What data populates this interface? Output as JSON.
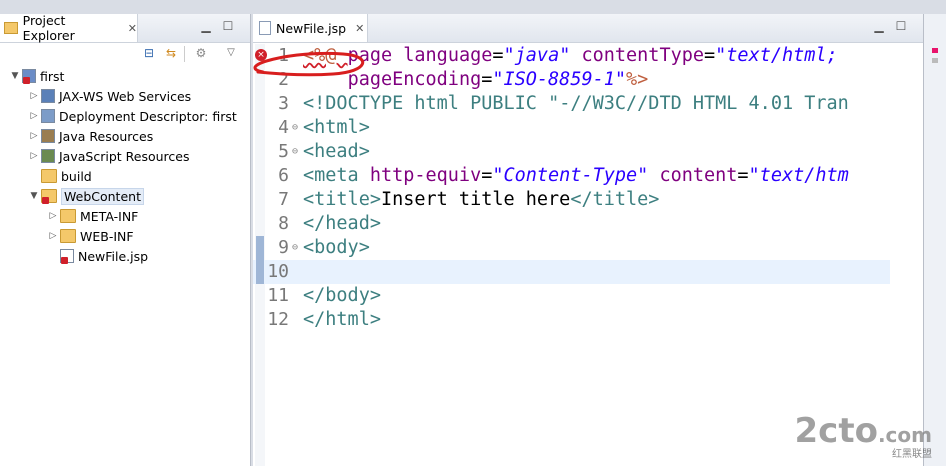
{
  "explorer": {
    "title": "Project Explorer",
    "tree": [
      {
        "label": "first",
        "indent": 0,
        "arrow": "▼",
        "icon": "project"
      },
      {
        "label": "JAX-WS Web Services",
        "indent": 1,
        "arrow": "▷",
        "icon": "ws"
      },
      {
        "label": "Deployment Descriptor: first",
        "indent": 1,
        "arrow": "▷",
        "icon": "dd"
      },
      {
        "label": "Java Resources",
        "indent": 1,
        "arrow": "▷",
        "icon": "java"
      },
      {
        "label": "JavaScript Resources",
        "indent": 1,
        "arrow": "▷",
        "icon": "js"
      },
      {
        "label": "build",
        "indent": 1,
        "arrow": "",
        "icon": "folder"
      },
      {
        "label": "WebContent",
        "indent": 1,
        "arrow": "▼",
        "icon": "webfolder",
        "selected": true
      },
      {
        "label": "META-INF",
        "indent": 2,
        "arrow": "▷",
        "icon": "folder"
      },
      {
        "label": "WEB-INF",
        "indent": 2,
        "arrow": "▷",
        "icon": "folder"
      },
      {
        "label": "NewFile.jsp",
        "indent": 2,
        "arrow": "",
        "icon": "jsp"
      }
    ]
  },
  "editor": {
    "tab_label": "NewFile.jsp",
    "lines": [
      {
        "num": "1",
        "fold": "",
        "error": true,
        "segments": [
          [
            "jsp",
            "<%@ "
          ],
          [
            "attr",
            "page "
          ],
          [
            "attr",
            "language"
          ],
          [
            "plain",
            "="
          ],
          [
            "val",
            "\"java\""
          ],
          [
            "plain",
            " "
          ],
          [
            "attr",
            "contentType"
          ],
          [
            "plain",
            "="
          ],
          [
            "val",
            "\"text/html;"
          ]
        ]
      },
      {
        "num": "2",
        "fold": "",
        "segments": [
          [
            "plain",
            "    "
          ],
          [
            "attr",
            "pageEncoding"
          ],
          [
            "plain",
            "="
          ],
          [
            "val",
            "\"ISO-8859-1\""
          ],
          [
            "jsp",
            "%>"
          ]
        ]
      },
      {
        "num": "3",
        "fold": "",
        "segments": [
          [
            "tag",
            "<!DOCTYPE "
          ],
          [
            "tag",
            "html "
          ],
          [
            "doctype",
            "PUBLIC "
          ],
          [
            "doctype",
            "\"-//W3C//DTD HTML 4.01 Tran"
          ]
        ]
      },
      {
        "num": "4",
        "fold": "⊖",
        "segments": [
          [
            "tag",
            "<html>"
          ]
        ]
      },
      {
        "num": "5",
        "fold": "⊖",
        "segments": [
          [
            "tag",
            "<head>"
          ]
        ]
      },
      {
        "num": "6",
        "fold": "",
        "segments": [
          [
            "tag",
            "<meta "
          ],
          [
            "attr",
            "http-equiv"
          ],
          [
            "plain",
            "="
          ],
          [
            "val",
            "\"Content-Type\""
          ],
          [
            "plain",
            " "
          ],
          [
            "attr",
            "content"
          ],
          [
            "plain",
            "="
          ],
          [
            "val",
            "\"text/htm"
          ]
        ]
      },
      {
        "num": "7",
        "fold": "",
        "segments": [
          [
            "tag",
            "<title>"
          ],
          [
            "plain",
            "Insert title here"
          ],
          [
            "tag",
            "</title>"
          ]
        ]
      },
      {
        "num": "8",
        "fold": "",
        "segments": [
          [
            "tag",
            "</head>"
          ]
        ]
      },
      {
        "num": "9",
        "fold": "⊖",
        "segments": [
          [
            "tag",
            "<body>"
          ]
        ]
      },
      {
        "num": "10",
        "fold": "",
        "current": true,
        "segments": []
      },
      {
        "num": "11",
        "fold": "",
        "segments": [
          [
            "tag",
            "</body>"
          ]
        ]
      },
      {
        "num": "12",
        "fold": "",
        "segments": [
          [
            "tag",
            "</html>"
          ]
        ]
      }
    ]
  },
  "watermark": {
    "main": "2cto",
    "suffix": ".com",
    "sub": "红黑联盟"
  }
}
